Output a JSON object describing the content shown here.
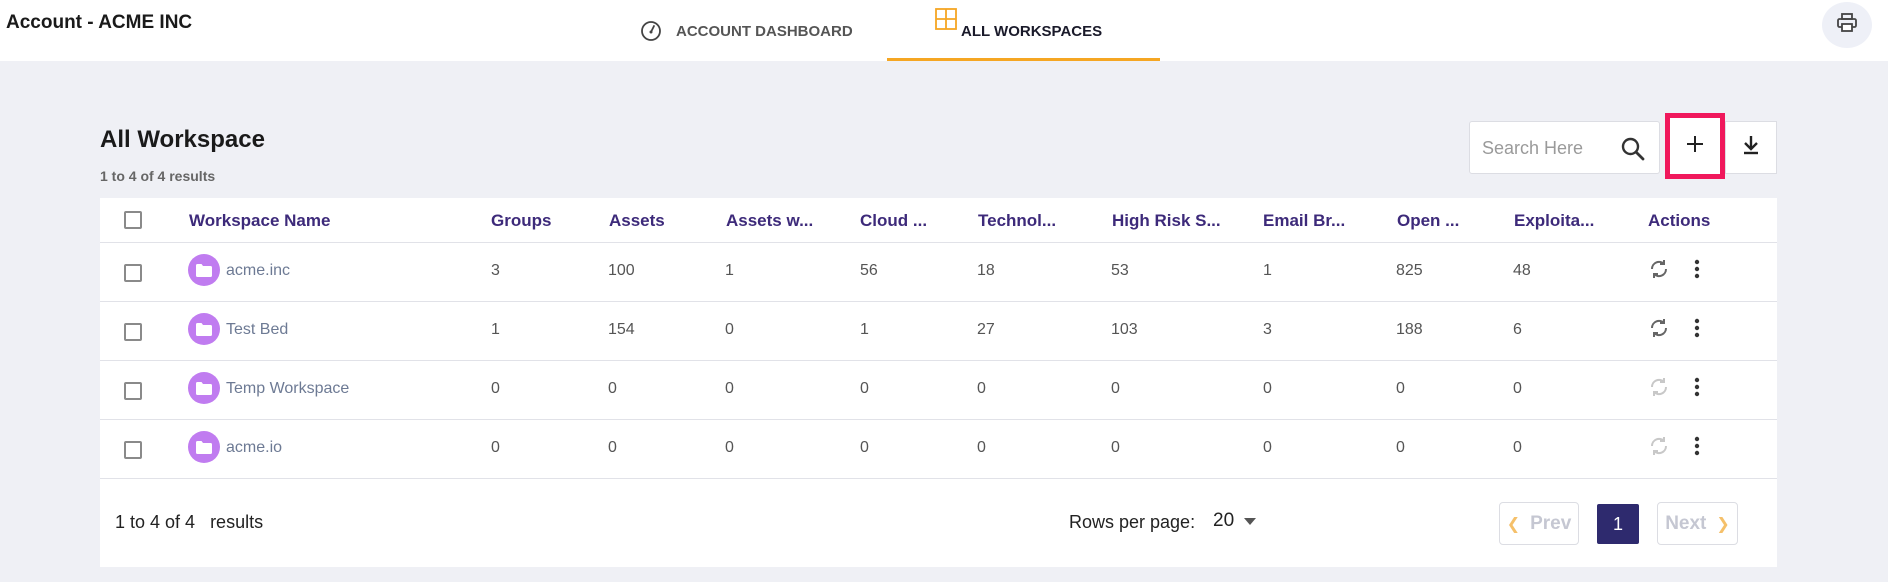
{
  "header": {
    "brand_prefix": "Account - ",
    "brand_name": "ACME INC",
    "tabs": [
      {
        "label": "ACCOUNT DASHBOARD",
        "icon": "gauge-icon",
        "active": false
      },
      {
        "label": "ALL WORKSPACES",
        "icon": "grid-icon",
        "active": true
      }
    ],
    "print_icon": "printer-icon"
  },
  "page": {
    "title": "All Workspace",
    "result_count": "1 to 4 of 4 results",
    "search_placeholder": "Search Here"
  },
  "table": {
    "columns": [
      "Workspace Name",
      "Groups",
      "Assets",
      "Assets w...",
      "Cloud ...",
      "Technol...",
      "High Risk S...",
      "Email Br...",
      "Open ...",
      "Exploita...",
      "Actions"
    ],
    "rows": [
      {
        "name": "acme.inc",
        "groups": "3",
        "assets": "100",
        "assets_w": "1",
        "cloud": "56",
        "technol": "18",
        "high_risk": "53",
        "email_br": "1",
        "open": "825",
        "exploita": "48",
        "sync_enabled": true
      },
      {
        "name": "Test Bed",
        "groups": "1",
        "assets": "154",
        "assets_w": "0",
        "cloud": "1",
        "technol": "27",
        "high_risk": "103",
        "email_br": "3",
        "open": "188",
        "exploita": "6",
        "sync_enabled": true
      },
      {
        "name": "Temp Workspace",
        "groups": "0",
        "assets": "0",
        "assets_w": "0",
        "cloud": "0",
        "technol": "0",
        "high_risk": "0",
        "email_br": "0",
        "open": "0",
        "exploita": "0",
        "sync_enabled": false
      },
      {
        "name": "acme.io",
        "groups": "0",
        "assets": "0",
        "assets_w": "0",
        "cloud": "0",
        "technol": "0",
        "high_risk": "0",
        "email_br": "0",
        "open": "0",
        "exploita": "0",
        "sync_enabled": false
      }
    ]
  },
  "footer": {
    "result_count": "1 to 4 of 4   results",
    "rows_per_page_label": "Rows per page:",
    "rows_per_page_value": "20",
    "prev_label": "Prev",
    "next_label": "Next",
    "current_page": "1"
  },
  "colors": {
    "accent": "#f5a623",
    "highlight": "#f0185c",
    "header_text": "#3d2a7a",
    "folder": "#c07cf0",
    "pagination_active": "#2e2a6e",
    "background": "#eff0f5"
  }
}
